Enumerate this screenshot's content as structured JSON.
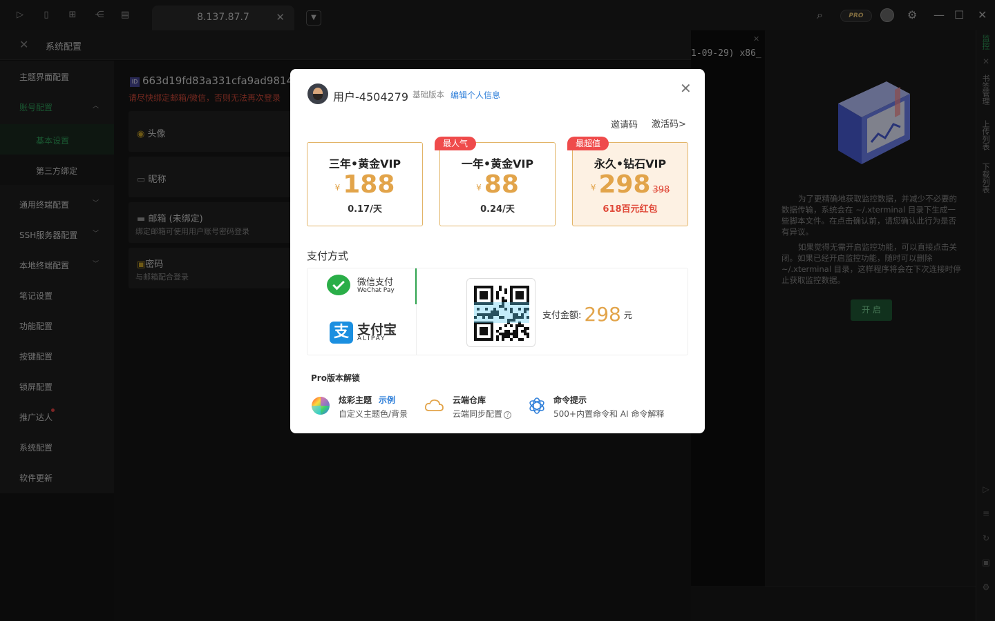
{
  "titlebar": {
    "tab_title": "8.137.87.7",
    "pro_label": "PRO"
  },
  "settings": {
    "title": "系统配置",
    "sidebar": [
      {
        "label": "主题界面配置"
      },
      {
        "label": "账号配置"
      },
      {
        "label": "基本设置"
      },
      {
        "label": "第三方绑定"
      },
      {
        "label": "通用终端配置"
      },
      {
        "label": "SSH服务器配置"
      },
      {
        "label": "本地终端配置"
      },
      {
        "label": "笔记设置"
      },
      {
        "label": "功能配置"
      },
      {
        "label": "按键配置"
      },
      {
        "label": "锁屏配置"
      },
      {
        "label": "推广达人"
      },
      {
        "label": "系统配置"
      },
      {
        "label": "软件更新"
      }
    ],
    "id_badge": "ID",
    "account_id": "663d19fd83a331cfa9ad9814",
    "warning": "请尽快绑定邮箱/微信，否则无法再次登录",
    "avatar_label": "头像",
    "nickname_label": "昵称",
    "email_label": "邮箱 (未绑定)",
    "email_sub": "绑定邮箱可使用用户账号密码登录",
    "password_label": "密码",
    "password_sub": "与邮箱配合登录"
  },
  "terminal": {
    "text": "1-09-29) x86_"
  },
  "monitor": {
    "para1": "为了更精确地获取监控数据，并减少不必要的数据传输，系统会在 ~/.xterminal 目录下生成一些脚本文件。在点击确认前，请您确认此行为是否有异议。",
    "para2": "如果觉得无需开启监控功能，可以直接点击关闭。如果已经开启监控功能，随时可以删除 ~/.xterminal 目录，这样程序将会在下次连接时停止获取监控数据。",
    "button": "开 启"
  },
  "rail": {
    "items": [
      "监控",
      "书签管理",
      "上传列表",
      "下载列表"
    ]
  },
  "modal": {
    "username": "用户-4504279",
    "version": "基础版本",
    "edit_link": "编辑个人信息",
    "invite": "邀请码",
    "activate": "激活码>",
    "plans": [
      {
        "name": "三年•黄金VIP",
        "currency": "¥",
        "price": "188",
        "sub": "0.17/天",
        "tag": ""
      },
      {
        "name": "一年•黄金VIP",
        "currency": "¥",
        "price": "88",
        "sub": "0.24/天",
        "tag": "最人气"
      },
      {
        "name": "永久•钻石VIP",
        "currency": "¥",
        "price": "298",
        "old_price": "398",
        "sub": "618百元红包",
        "tag": "最超值"
      }
    ],
    "pay_title": "支付方式",
    "wechat_name": "微信支付",
    "wechat_en": "WeChat Pay",
    "alipay_name": "支付宝",
    "alipay_en": "ALIPAY",
    "alipay_icon": "支",
    "amount_label": "支付金额:",
    "amount_value": "298",
    "amount_unit": "元",
    "pro_title": "Pro版本解锁",
    "features": [
      {
        "title": "炫彩主题",
        "link": "示例",
        "sub": "自定义主题色/背景"
      },
      {
        "title": "云端仓库",
        "sub": "云端同步配置"
      },
      {
        "title": "命令提示",
        "sub": "500+内置命令和 AI 命令解释"
      }
    ]
  }
}
